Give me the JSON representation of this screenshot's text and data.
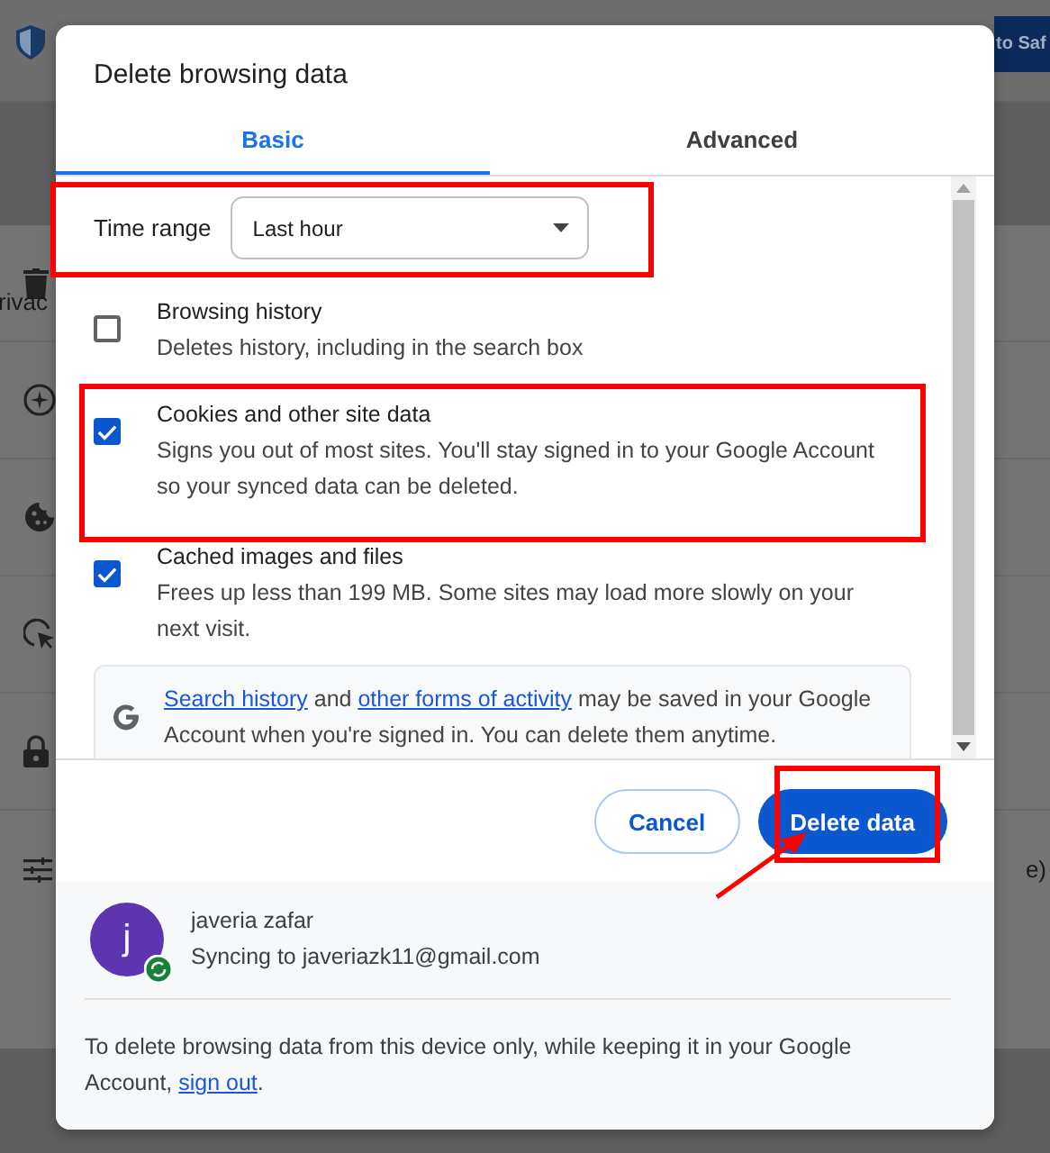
{
  "background": {
    "banner_button": "to Saf",
    "section_label": "rivac",
    "row_text": "e)"
  },
  "dialog": {
    "title": "Delete browsing data",
    "tabs": [
      {
        "label": "Basic",
        "selected": true
      },
      {
        "label": "Advanced",
        "selected": false
      }
    ],
    "time_range": {
      "label": "Time range",
      "value": "Last hour"
    },
    "options": [
      {
        "title": "Browsing history",
        "description": "Deletes history, including in the search box",
        "checked": false
      },
      {
        "title": "Cookies and other site data",
        "description": "Signs you out of most sites. You'll stay signed in to your Google Account so your synced data can be deleted.",
        "checked": true
      },
      {
        "title": "Cached images and files",
        "description": "Frees up less than 199 MB. Some sites may load more slowly on your next visit.",
        "checked": true
      }
    ],
    "info": {
      "link_1": "Search history",
      "text_1": " and ",
      "link_2": "other forms of activity",
      "text_2": " may be saved in your Google Account when you're signed in. You can delete them anytime."
    },
    "buttons": {
      "cancel": "Cancel",
      "confirm": "Delete data"
    },
    "account": {
      "initial": "j",
      "name": "javeria zafar",
      "status": "Syncing to javeriazk11@gmail.com"
    },
    "note": {
      "text": "To delete browsing data from this device only, while keeping it in your Google Account, ",
      "link": "sign out",
      "end": "."
    }
  }
}
